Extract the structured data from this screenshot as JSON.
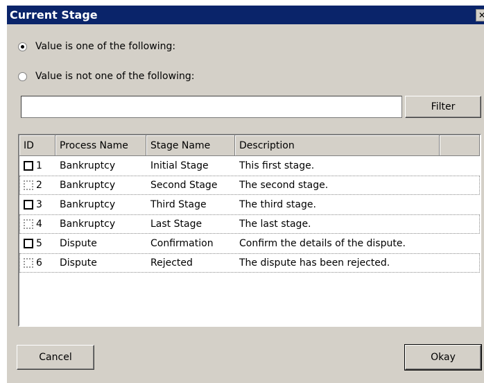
{
  "dialog": {
    "title": "Current Stage",
    "close_glyph": "✕"
  },
  "options": {
    "include_label": "Value is one of the following:",
    "exclude_label": "Value is not one of the following:",
    "selected": "include"
  },
  "filter": {
    "value": "",
    "button_label": "Filter"
  },
  "table": {
    "columns": [
      "ID",
      "Process Name",
      "Stage Name",
      "Description"
    ],
    "rows": [
      {
        "id": "1",
        "process": "Bankruptcy",
        "stage": "Initial Stage",
        "description": "This first stage."
      },
      {
        "id": "2",
        "process": "Bankruptcy",
        "stage": "Second Stage",
        "description": "The second stage."
      },
      {
        "id": "3",
        "process": "Bankruptcy",
        "stage": "Third Stage",
        "description": "The third stage."
      },
      {
        "id": "4",
        "process": "Bankruptcy",
        "stage": "Last Stage",
        "description": "The last stage."
      },
      {
        "id": "5",
        "process": "Dispute",
        "stage": "Confirmation",
        "description": "Confirm the details of the dispute."
      },
      {
        "id": "6",
        "process": "Dispute",
        "stage": "Rejected",
        "description": "The dispute has been rejected."
      }
    ]
  },
  "footer": {
    "cancel_label": "Cancel",
    "okay_label": "Okay"
  }
}
